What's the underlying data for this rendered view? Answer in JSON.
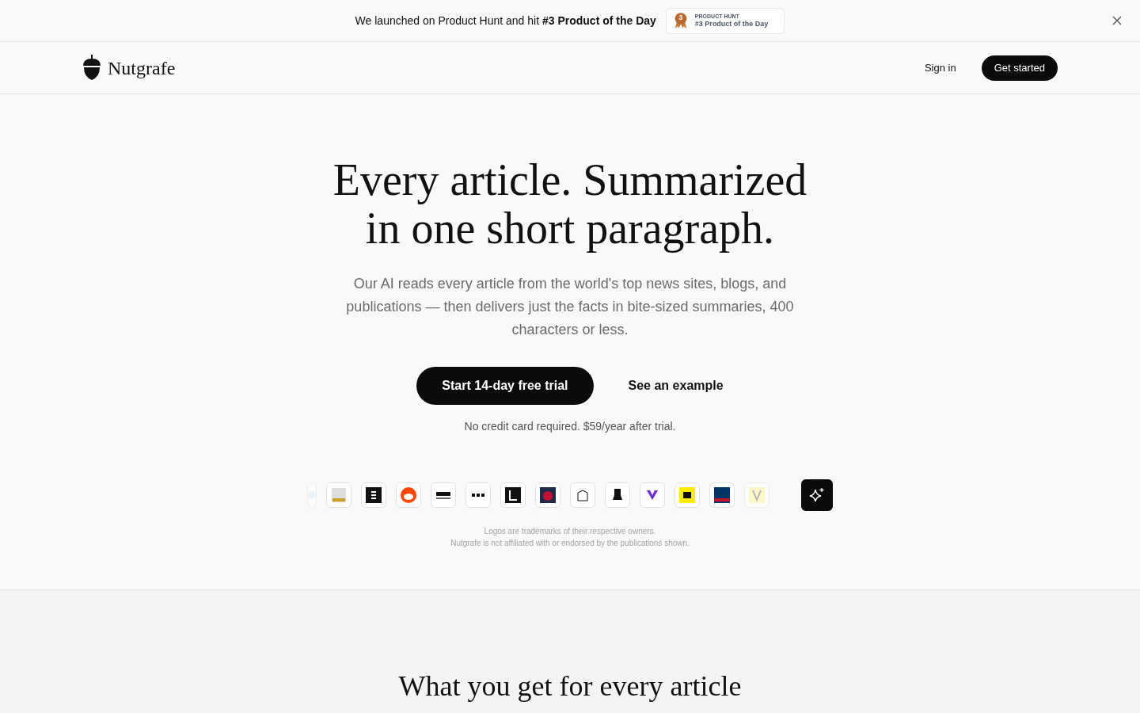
{
  "announcement": {
    "text": "We launched on Product Hunt and hit **#3 Product of the Day**",
    "badge": {
      "eyebrow": "PRODUCT HUNT",
      "title": "#3 Product of the Day",
      "rank": "3"
    }
  },
  "header": {
    "brand": "Nutgrafe",
    "sign_in": "Sign in",
    "get_started": "Get started"
  },
  "hero": {
    "title_lines": [
      "Every article. Summarized",
      "in one short paragraph."
    ],
    "subtitle": "Our AI reads every article from the world's top news sites, blogs, and publications — then delivers just the facts in bite-sized summaries, 400 characters or less.",
    "primary_button": "Start 14-day free trial",
    "secondary_button": "See an example",
    "note": "No credit card required. $59/year after trial."
  },
  "disclaimer": [
    "Logos are trademarks of their respective owners.",
    "Nutgrafe is not affiliated with or endorsed by the publications shown."
  ],
  "features": {
    "heading": "What you get for every article"
  }
}
